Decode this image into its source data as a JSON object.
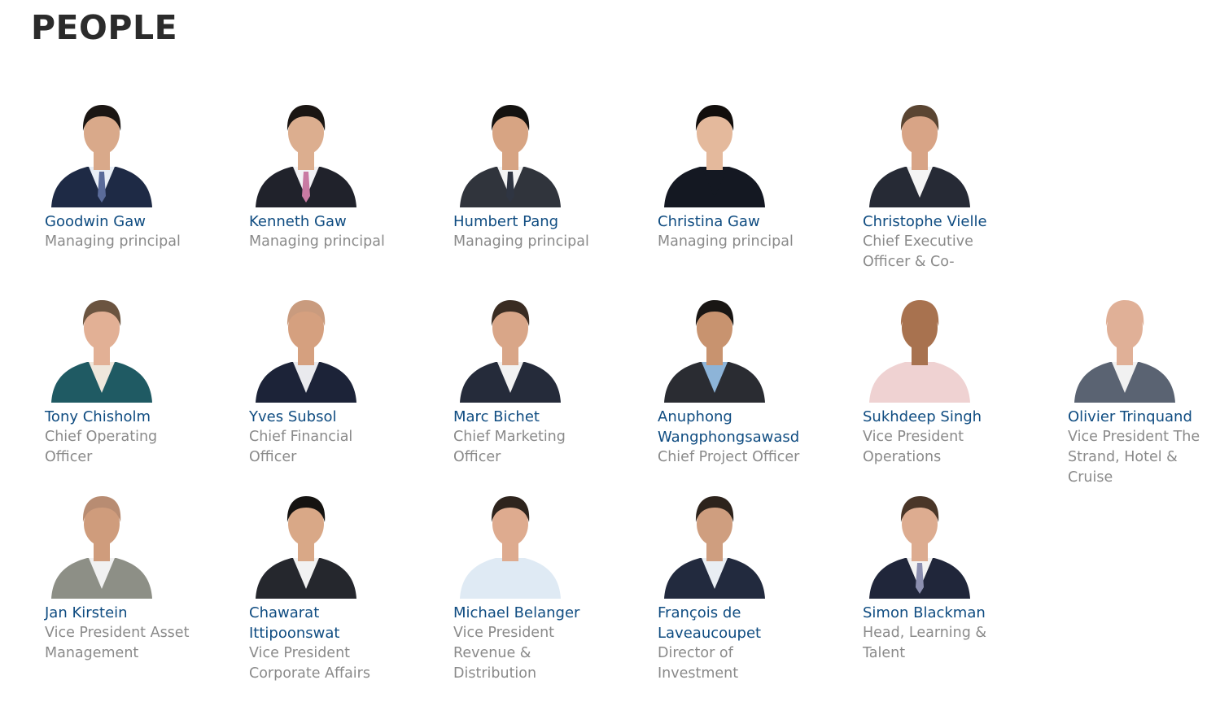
{
  "page": {
    "title": "PEOPLE"
  },
  "colors": {
    "name_link": "#0f4c81",
    "role_text": "#8a8a8a",
    "title_text": "#2b2b2b"
  },
  "people": [
    {
      "name": "Goodwin Gaw",
      "role": "Managing principal",
      "skin": "#d9a98a",
      "hair": "#1b1613",
      "jacket": "#1e2a45",
      "shirt": "#e8eef6",
      "tie": "#5a6b9a"
    },
    {
      "name": "Kenneth Gaw",
      "role": "Managing principal",
      "skin": "#dcae8f",
      "hair": "#1b1613",
      "jacket": "#20222b",
      "shirt": "#f2f2f5",
      "tie": "#c97aa3"
    },
    {
      "name": "Humbert Pang",
      "role": "Managing principal",
      "skin": "#d7a483",
      "hair": "#141210",
      "jacket": "#30343c",
      "shirt": "#f4f4f4",
      "tie": "#2f3542"
    },
    {
      "name": "Christina Gaw",
      "role": "Managing principal",
      "skin": "#e4b99c",
      "hair": "#120e0c",
      "jacket": "#141822",
      "shirt": "#141822",
      "tie": ""
    },
    {
      "name": "Christophe Vielle",
      "role": "Chief Executive Officer & Co-",
      "skin": "#d8a486",
      "hair": "#5a4532",
      "jacket": "#262a35",
      "shirt": "#f4f4f4",
      "tie": ""
    },
    {
      "name": "Tony Chisholm",
      "role": "Chief Operating Officer",
      "skin": "#e2b095",
      "hair": "#6b5440",
      "jacket": "#1f5a63",
      "shirt": "#efe7dc",
      "tie": ""
    },
    {
      "name": "Yves Subsol",
      "role": "Chief Financial Officer",
      "skin": "#d5a07f",
      "hair": "#c99b7e",
      "jacket": "#1c2338",
      "shirt": "#e9eaee",
      "tie": ""
    },
    {
      "name": "Marc Bichet",
      "role": "Chief Marketing Officer",
      "skin": "#d9a688",
      "hair": "#3a2c22",
      "jacket": "#252b3a",
      "shirt": "#f2f2f2",
      "tie": ""
    },
    {
      "name": "Anuphong Wangphongsawasd",
      "role": "Chief Project Officer",
      "skin": "#c8936f",
      "hair": "#191614",
      "jacket": "#2a2c32",
      "shirt": "#8db4d8",
      "tie": ""
    },
    {
      "name": "Sukhdeep Singh",
      "role": "Vice President Operations",
      "skin": "#a8724f",
      "hair": "#a8724f",
      "jacket": "#efd2d2",
      "shirt": "#efd2d2",
      "tie": ""
    },
    {
      "name": "Olivier Trinquand",
      "role": "Vice President The Strand, Hotel & Cruise",
      "skin": "#e0b097",
      "hair": "#e0b097",
      "jacket": "#5a6372",
      "shirt": "#f1f1f1",
      "tie": ""
    },
    {
      "name": "Jan Kirstein",
      "role": "Vice President Asset Management",
      "skin": "#cf9c7c",
      "hair": "#b88c72",
      "jacket": "#8d8f86",
      "shirt": "#f1f1f1",
      "tie": ""
    },
    {
      "name": "Chawarat Ittipoonswat",
      "role": "Vice President Corporate Affairs",
      "skin": "#d9a887",
      "hair": "#151311",
      "jacket": "#25272d",
      "shirt": "#f2f2f2",
      "tie": ""
    },
    {
      "name": "Michael Belanger",
      "role": "Vice President Revenue & Distribution",
      "skin": "#deab8f",
      "hair": "#2e241d",
      "jacket": "#dfeaf4",
      "shirt": "#dfeaf4",
      "tie": ""
    },
    {
      "name": "François de Laveaucoupet",
      "role": "Director of Investment",
      "skin": "#cf9e7f",
      "hair": "#2d231c",
      "jacket": "#222a3e",
      "shirt": "#e9eef3",
      "tie": ""
    },
    {
      "name": "Simon Blackman",
      "role": "Head, Learning & Talent",
      "skin": "#ddac90",
      "hair": "#4a3628",
      "jacket": "#20263a",
      "shirt": "#f3f3f3",
      "tie": "#8c8fb0"
    }
  ]
}
